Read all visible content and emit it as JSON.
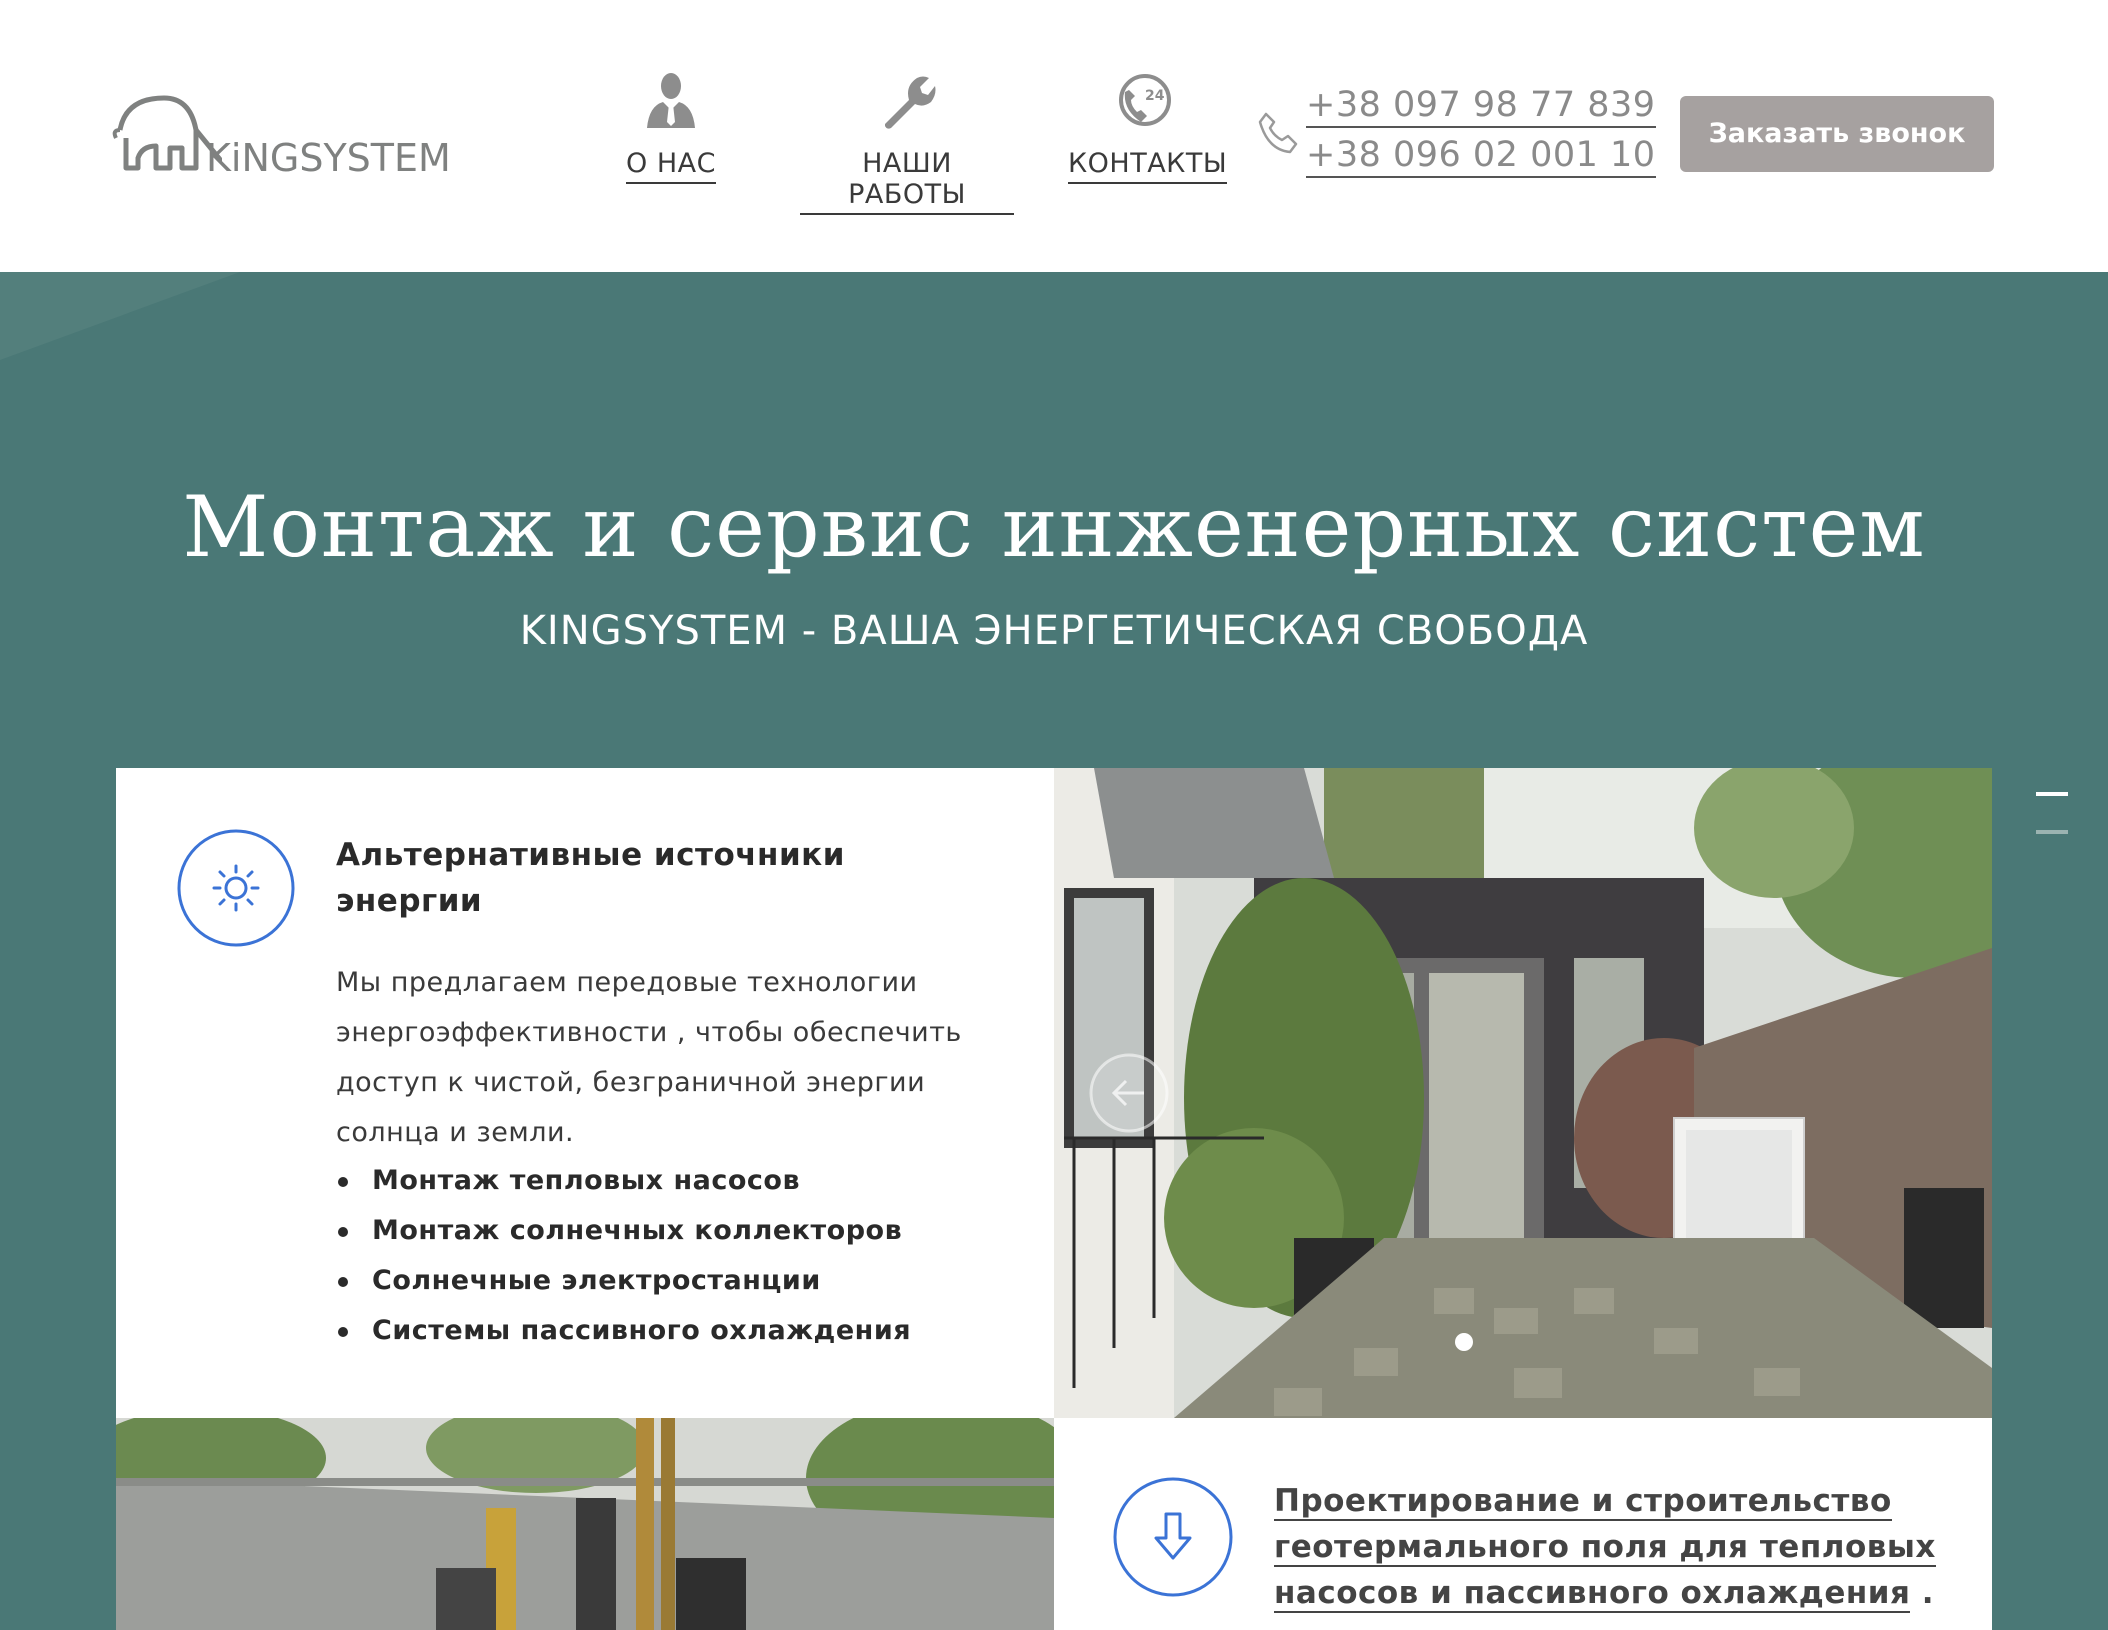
{
  "header": {
    "logo_text": "KiNGSYSTEM",
    "nav": [
      {
        "label": "О НАС",
        "icon": "person-tie-icon"
      },
      {
        "label": "НАШИ РАБОТЫ",
        "icon": "wrench-icon"
      },
      {
        "label": "КОНТАКТЫ",
        "icon": "phone-24-icon"
      }
    ],
    "phones": [
      "+38 097 98 77 839",
      "+38 096 02 001 10"
    ],
    "call_button": "Заказать звонок"
  },
  "hero": {
    "title": "Монтаж и сервис инженерных систем",
    "subtitle": "KINGSYSTEM - ВАША ЭНЕРГЕТИЧЕСКАЯ СВОБОДА"
  },
  "card1": {
    "icon": "sun-icon",
    "title": "Альтернативные источники энергии",
    "text": "Мы предлагаем передовые технологии энергоэффективности , чтобы обеспечить доступ к чистой, безграничной энергии солнца и земли.",
    "items": [
      "Монтаж тепловых насосов",
      "Монтаж солнечных коллекторов",
      "Солнечные электростанции",
      "Системы пассивного охлаждения"
    ]
  },
  "card2": {
    "icon": "arrow-down-icon",
    "title": "Проектирование и строительство геотермального поля для тепловых насосов и пассивного охлаждения",
    "title_suffix": " ."
  },
  "colors": {
    "hero_bg": "#4a7876",
    "button_bg": "#a6a1a0",
    "icon_blue": "#3b73d6",
    "nav_icon_gray": "#8d8d8d"
  }
}
